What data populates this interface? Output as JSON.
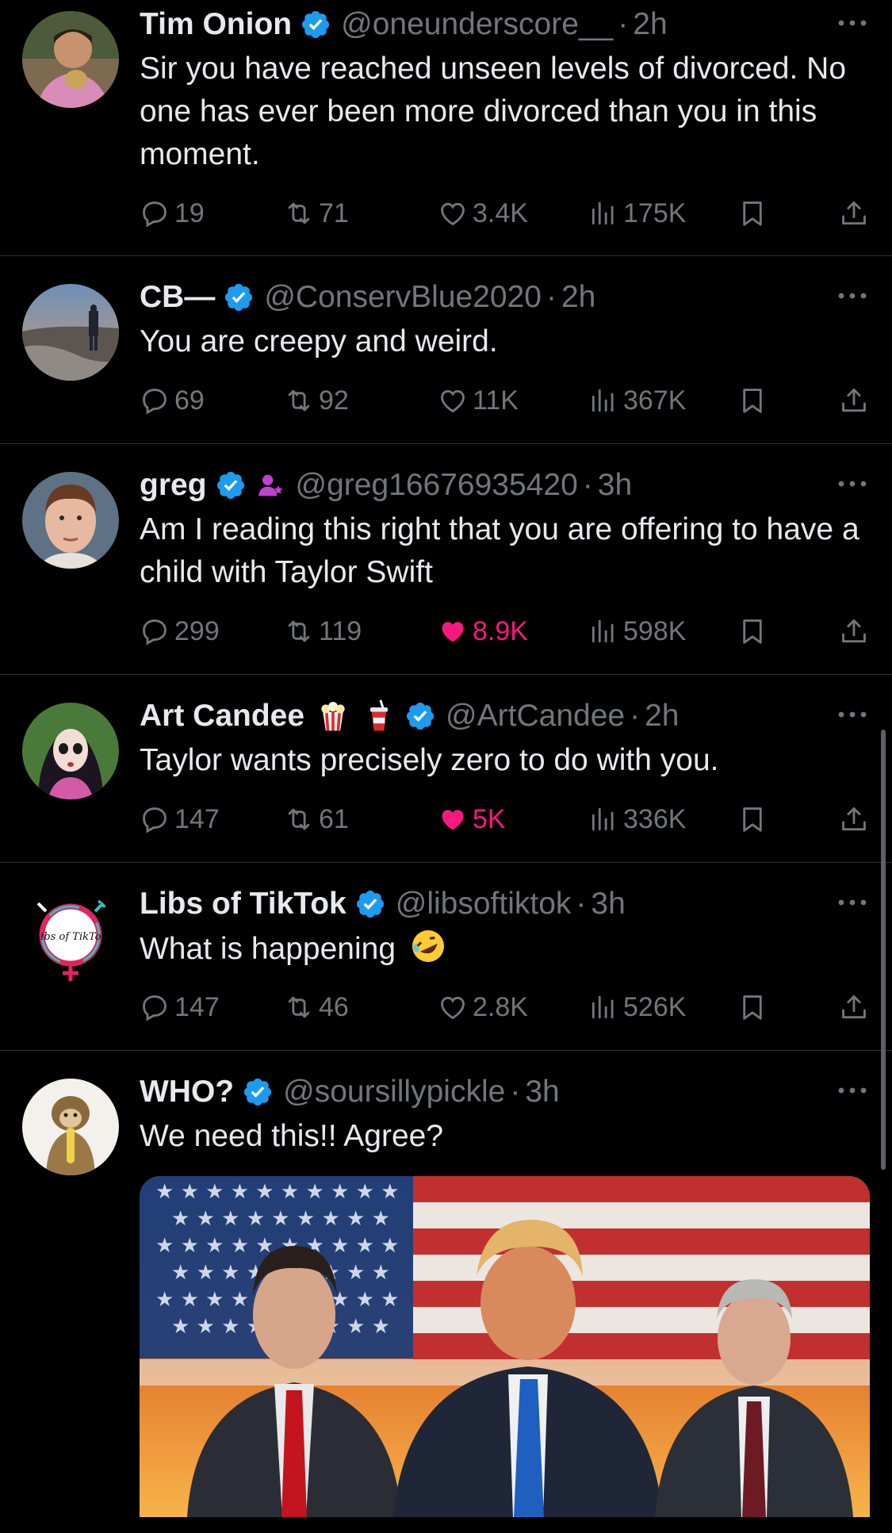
{
  "tweets": [
    {
      "name": "Tim Onion",
      "handle": "@oneunderscore__",
      "time": "2h",
      "text": "Sir you have reached unseen levels of divorced. No one has ever been more divorced than you in this moment.",
      "replies": "19",
      "reposts": "71",
      "likes": "3.4K",
      "views": "175K",
      "liked": false
    },
    {
      "name": "CB—",
      "handle": "@ConservBlue2020",
      "time": "2h",
      "text": "You are creepy and weird.",
      "replies": "69",
      "reposts": "92",
      "likes": "11K",
      "views": "367K",
      "liked": false
    },
    {
      "name": "greg",
      "handle": "@greg16676935420",
      "time": "3h",
      "text": "Am I reading this right that you are offering to have a child with Taylor Swift",
      "replies": "299",
      "reposts": "119",
      "likes": "8.9K",
      "views": "598K",
      "liked": true
    },
    {
      "name": "Art Candee",
      "handle": "@ArtCandee",
      "time": "2h",
      "text": "Taylor wants precisely zero to do with you.",
      "replies": "147",
      "reposts": "61",
      "likes": "5K",
      "views": "336K",
      "liked": true
    },
    {
      "name": "Libs of TikTok",
      "handle": "@libsoftiktok",
      "time": "3h",
      "text": "What is happening",
      "replies": "147",
      "reposts": "46",
      "likes": "2.8K",
      "views": "526K",
      "liked": false
    },
    {
      "name": "WHO?",
      "handle": "@soursillypickle",
      "time": "3h",
      "text": "We need this!! Agree?",
      "liked": false
    }
  ],
  "colors": {
    "background": "#000000",
    "text": "#e7e9ea",
    "muted": "#71767b",
    "verified": "#1d9bf0",
    "like": "#f91880",
    "divider": "#2f3336"
  },
  "icons": {
    "reply": "speech-bubble-icon",
    "repost": "repost-arrows-icon",
    "like": "heart-icon",
    "views": "bar-chart-icon",
    "bookmark": "bookmark-icon",
    "share": "share-upload-icon",
    "more": "more-dots-icon"
  },
  "avatars": {
    "libs_of_tiktok_logo": "Libs of TikTok"
  }
}
